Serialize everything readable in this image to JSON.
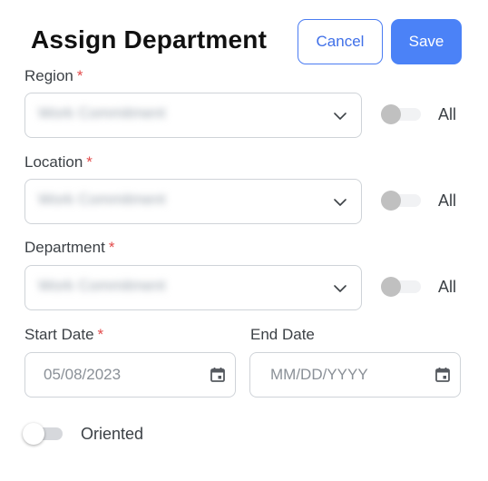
{
  "header": {
    "title": "Assign Department",
    "cancel_label": "Cancel",
    "save_label": "Save"
  },
  "form": {
    "region": {
      "label": "Region",
      "required_mark": "*",
      "value": "Work Commitment",
      "toggle_label": "All"
    },
    "location": {
      "label": "Location",
      "required_mark": "*",
      "value": "Work Commitment",
      "toggle_label": "All"
    },
    "department": {
      "label": "Department",
      "required_mark": "*",
      "value": "Work Commitment",
      "toggle_label": "All"
    },
    "start_date": {
      "label": "Start Date",
      "required_mark": "*",
      "value": "05/08/2023"
    },
    "end_date": {
      "label": "End Date",
      "placeholder": "MM/DD/YYYY"
    },
    "oriented": {
      "label": "Oriented"
    }
  },
  "icons": {
    "dropdown": "chevron-down-icon",
    "calendar": "calendar-icon"
  },
  "colors": {
    "primary": "#4b82f7",
    "required": "#e24b4b"
  }
}
